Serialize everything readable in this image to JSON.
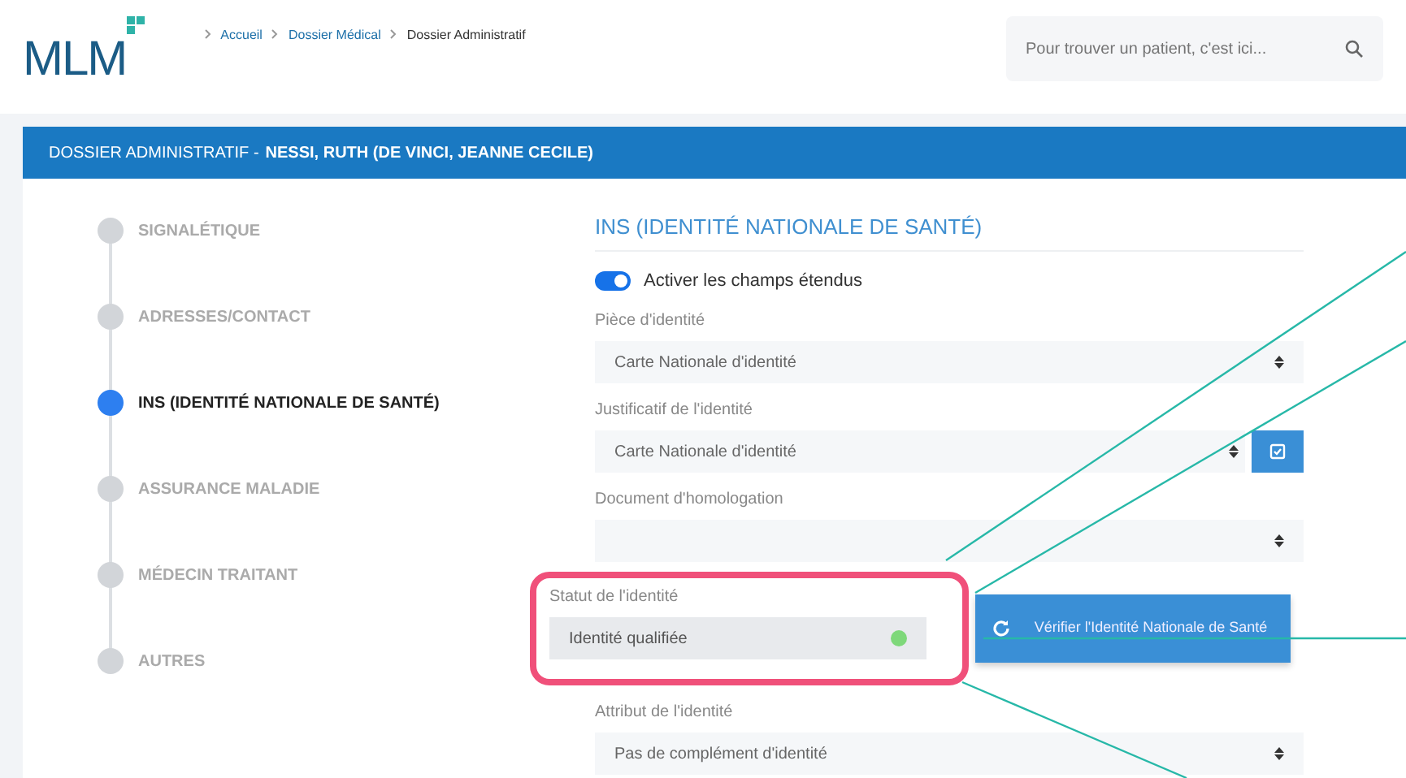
{
  "logo": {
    "text": "MLM"
  },
  "breadcrumb": [
    "Accueil",
    "Dossier Médical",
    "Dossier Administratif"
  ],
  "search": {
    "placeholder": "Pour trouver un patient, c'est ici..."
  },
  "header": {
    "title": "DOSSIER ADMINISTRATIF -",
    "patient": "NESSI, RUTH (DE VINCI, JEANNE CECILE)"
  },
  "steps": [
    {
      "label": "SIGNALÉTIQUE",
      "selected": false
    },
    {
      "label": "ADRESSES/CONTACT",
      "selected": false
    },
    {
      "label": "INS (IDENTITÉ NATIONALE DE SANTÉ)",
      "selected": true
    },
    {
      "label": "ASSURANCE MALADIE",
      "selected": false
    },
    {
      "label": "MÉDECIN TRAITANT",
      "selected": false
    },
    {
      "label": "AUTRES",
      "selected": false
    }
  ],
  "section": {
    "title": "INS (IDENTITÉ NATIONALE DE SANTÉ)",
    "toggle": {
      "label": "Activer les champs étendus",
      "on": true
    },
    "fields": [
      {
        "kind": "select",
        "label": "Pièce d'identité",
        "value": "Carte Nationale d'identité"
      },
      {
        "kind": "select-button",
        "label": "Justificatif de l'identité",
        "value": "Carte Nationale d'identité"
      },
      {
        "kind": "select",
        "label": "Document d'homologation"
      },
      {
        "kind": "status",
        "label": "Statut de l'identité",
        "value": "Identité qualifiée",
        "color": "#7ed87a",
        "highlighted": true,
        "action": "Vérifier l'Identité Nationale de Santé"
      },
      {
        "kind": "select",
        "label": "Attribut de l'identité",
        "value": "Pas de complément d'identité"
      }
    ]
  }
}
